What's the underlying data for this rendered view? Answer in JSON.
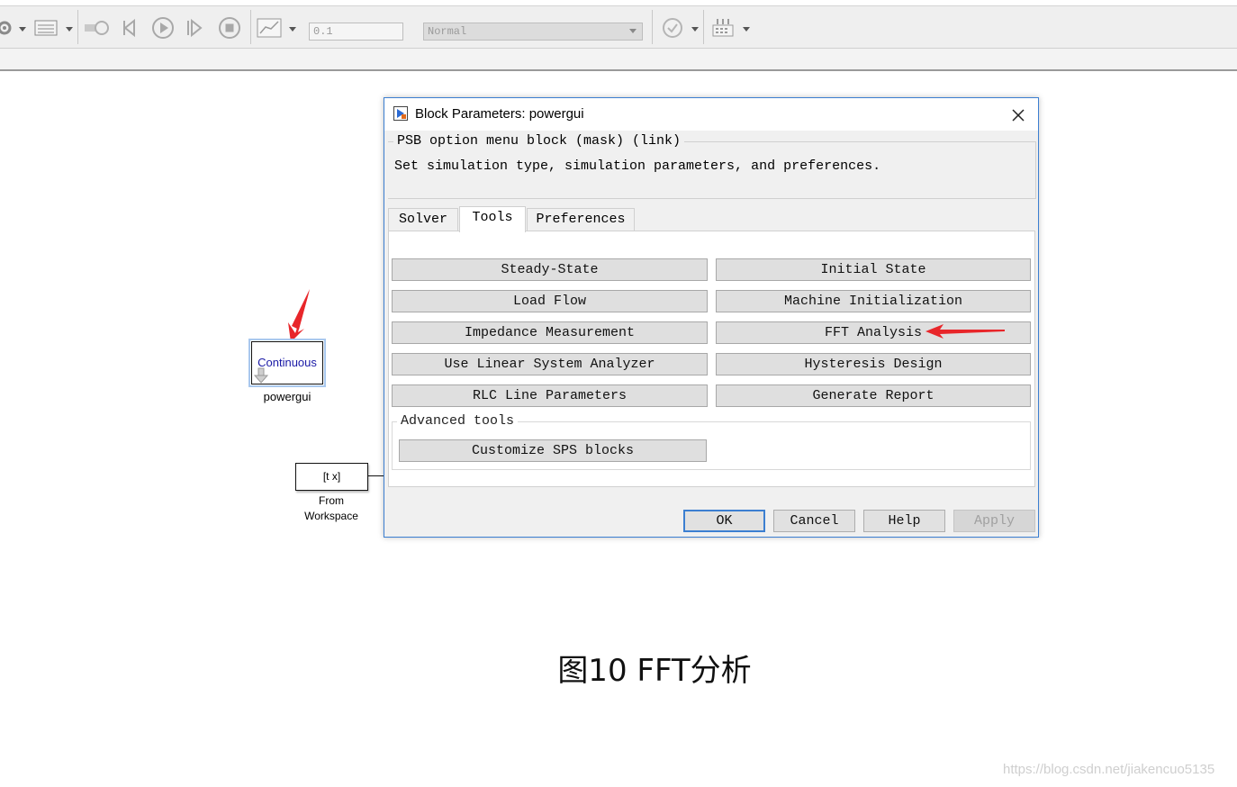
{
  "toolbar": {
    "step_size": "0.1",
    "sim_mode": "Normal"
  },
  "diagram": {
    "powergui_block_text": "Continuous",
    "powergui_label": "powergui",
    "from_workspace_text": "[t x]",
    "from_workspace_label_line1": "From",
    "from_workspace_label_line2": "Workspace"
  },
  "dialog": {
    "title": "Block Parameters: powergui",
    "group_title": "PSB option menu block (mask) (link)",
    "description": "Set simulation type, simulation parameters, and preferences.",
    "tabs": [
      {
        "label": "Solver",
        "active": false
      },
      {
        "label": "Tools",
        "active": true
      },
      {
        "label": "Preferences",
        "active": false
      }
    ],
    "tools": {
      "steady_state": "Steady-State",
      "initial_state": "Initial State",
      "load_flow": "Load Flow",
      "machine_init": "Machine Initialization",
      "impedance": "Impedance Measurement",
      "fft": "FFT Analysis",
      "linear_analyzer": "Use Linear System Analyzer",
      "hysteresis": "Hysteresis Design",
      "rlc": "RLC Line Parameters",
      "report": "Generate Report"
    },
    "advanced": {
      "title": "Advanced tools",
      "customize": "Customize SPS blocks"
    },
    "buttons": {
      "ok": "OK",
      "cancel": "Cancel",
      "help": "Help",
      "apply": "Apply"
    }
  },
  "annotation_color": "#e8262a",
  "caption": "图10  FFT分析",
  "watermark": "https://blog.csdn.net/jiakencuo5135"
}
